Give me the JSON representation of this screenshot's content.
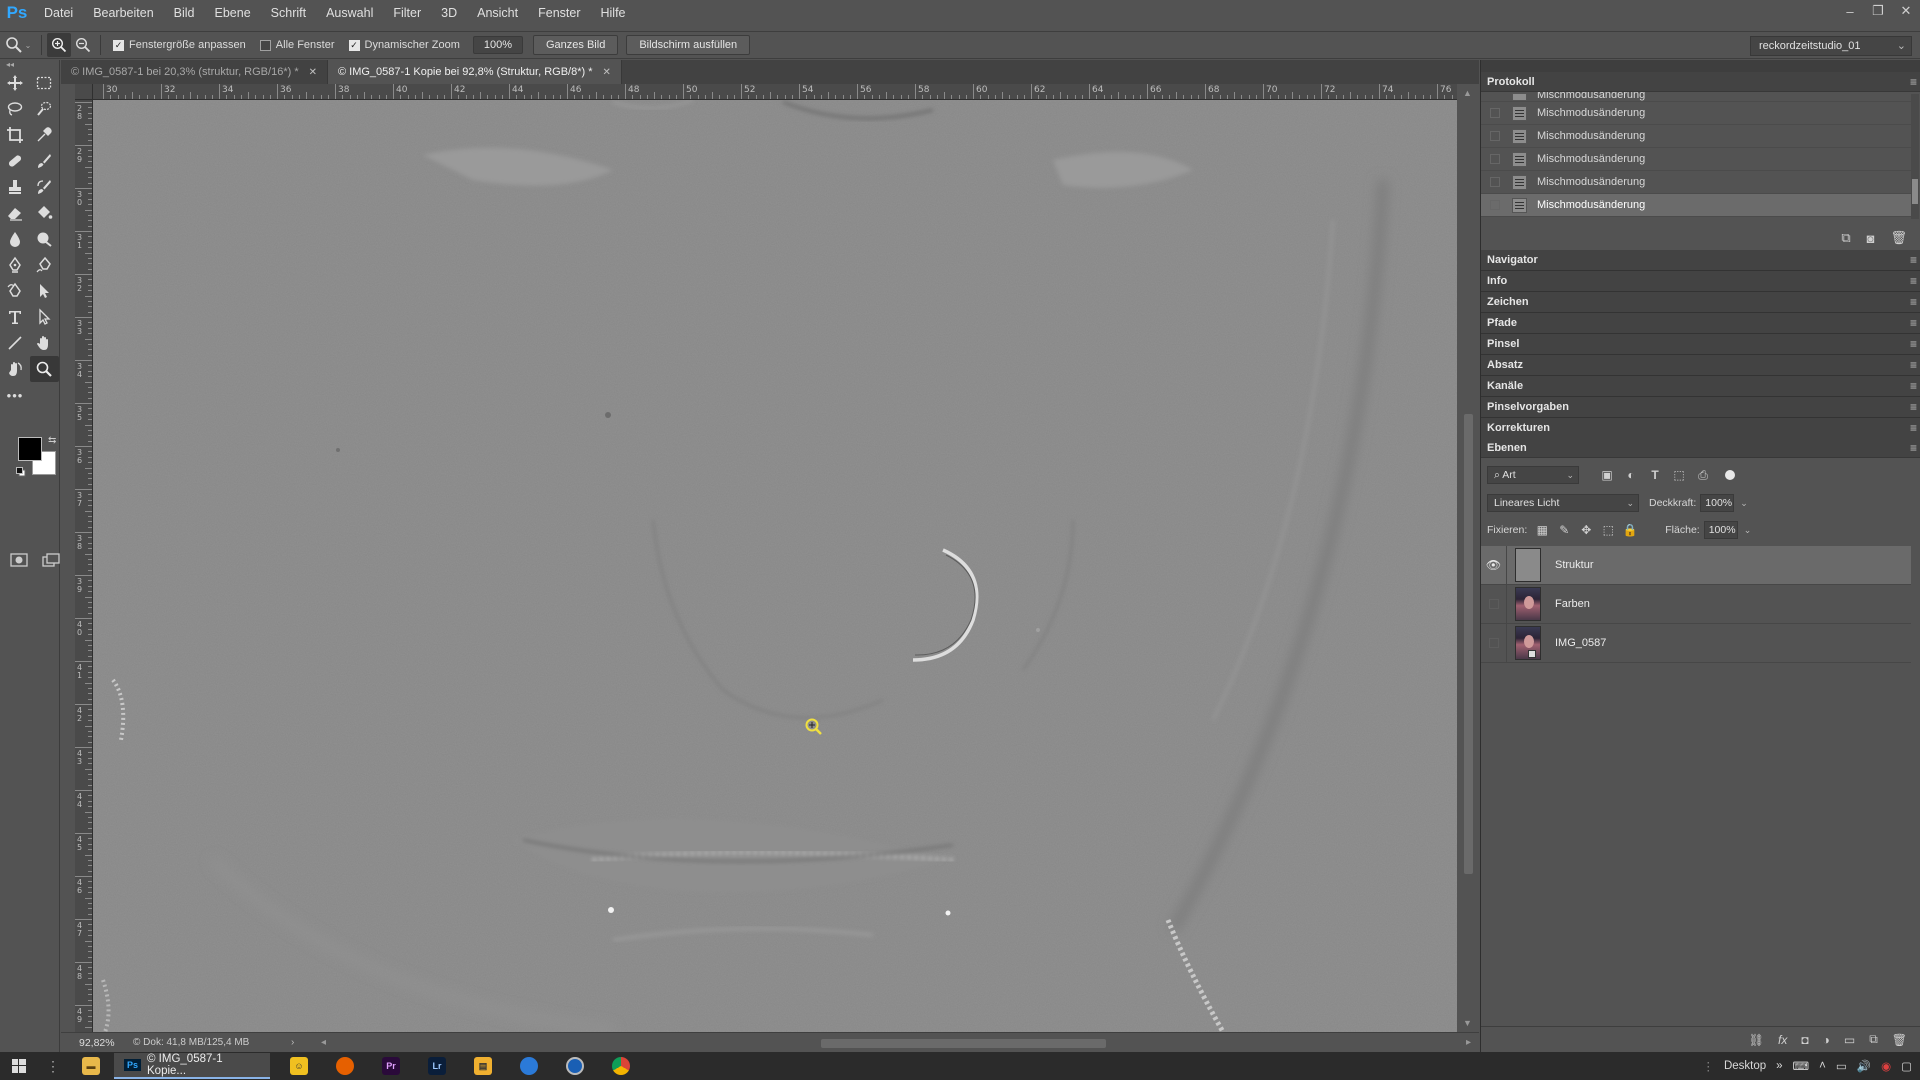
{
  "app": {
    "logo": "Ps"
  },
  "menu": [
    "Datei",
    "Bearbeiten",
    "Bild",
    "Ebene",
    "Schrift",
    "Auswahl",
    "Filter",
    "3D",
    "Ansicht",
    "Fenster",
    "Hilfe"
  ],
  "window_controls": {
    "minimize": "–",
    "restore": "❐",
    "close": "✕"
  },
  "options": {
    "tool_icon": "zoom-icon",
    "zoom_in_label": "+",
    "zoom_out_label": "−",
    "resize_windows": {
      "label": "Fenstergröße anpassen",
      "checked": true
    },
    "all_windows": {
      "label": "Alle Fenster",
      "checked": false
    },
    "scrubby_zoom": {
      "label": "Dynamischer Zoom",
      "checked": true
    },
    "zoom_100": "100%",
    "fit_screen": "Ganzes Bild",
    "fill_screen": "Bildschirm ausfüllen",
    "workspace": "reckordzeitstudio_01"
  },
  "doc_tabs": [
    {
      "label": "© IMG_0587-1 bei 20,3% (struktur, RGB/16*) *",
      "active": false
    },
    {
      "label": "© IMG_0587-1 Kopie bei 92,8% (Struktur, RGB/8*) *",
      "active": true
    }
  ],
  "ruler_h_labels": [
    "30",
    "32",
    "34",
    "36",
    "38",
    "40",
    "42",
    "44",
    "46",
    "48",
    "50",
    "52",
    "54",
    "56",
    "58",
    "60",
    "62",
    "64",
    "66",
    "68",
    "70",
    "72",
    "74",
    "76"
  ],
  "ruler_v_labels": [
    "28",
    "29",
    "30",
    "31",
    "32",
    "33",
    "34",
    "35",
    "36",
    "37",
    "38",
    "39",
    "40",
    "41",
    "42",
    "43",
    "44",
    "45",
    "46",
    "47",
    "48",
    "49"
  ],
  "status": {
    "zoom": "92,82%",
    "doc_size": "Dok: 41,8 MB/125,4 MB",
    "arrow": "›"
  },
  "history": {
    "title": "Protokoll",
    "items": [
      {
        "label": "Mischmodusänderung",
        "active": false
      },
      {
        "label": "Mischmodusänderung",
        "active": false
      },
      {
        "label": "Mischmodusänderung",
        "active": false
      },
      {
        "label": "Mischmodusänderung",
        "active": false
      },
      {
        "label": "Mischmodusänderung",
        "active": false
      },
      {
        "label": "Mischmodusänderung",
        "active": true
      }
    ]
  },
  "collapsed_panels": [
    "Navigator",
    "Info",
    "Zeichen",
    "Pfade",
    "Pinsel",
    "Absatz",
    "Kanäle",
    "Pinselvorgaben",
    "Korrekturen"
  ],
  "layers": {
    "title": "Ebenen",
    "kind_filter": "Art",
    "blend_mode": "Lineares Licht",
    "opacity_label": "Deckkraft:",
    "opacity_value": "100%",
    "lock_label": "Fixieren:",
    "fill_label": "Fläche:",
    "fill_value": "100%",
    "items": [
      {
        "name": "Struktur",
        "visible": true,
        "active": true,
        "thumb": "gray"
      },
      {
        "name": "Farben",
        "visible": false,
        "active": false,
        "thumb": "portrait"
      },
      {
        "name": "IMG_0587",
        "visible": false,
        "active": false,
        "thumb": "portrait"
      }
    ]
  },
  "taskbar": {
    "active_app": "© IMG_0587-1 Kopie...",
    "desktop_label": "Desktop"
  },
  "colors": {
    "accent": "#31a8ff",
    "canvas_gray": "#878787",
    "cursor": "#f0e040"
  }
}
